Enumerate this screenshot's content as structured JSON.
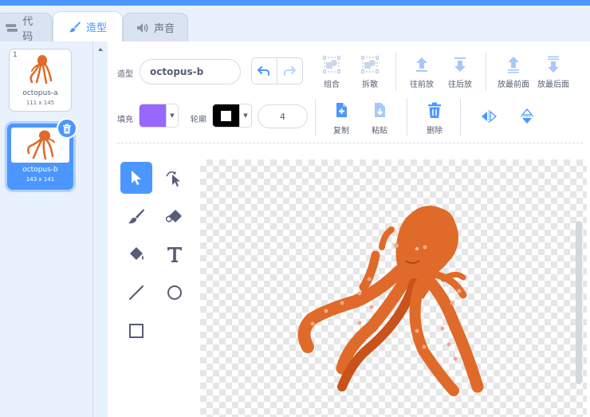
{
  "tabs": [
    {
      "label": "代码",
      "icon": "code-icon"
    },
    {
      "label": "造型",
      "icon": "brush-icon"
    },
    {
      "label": "声音",
      "icon": "speaker-icon"
    }
  ],
  "costumes": [
    {
      "index": "1",
      "name": "octopus-a",
      "size": "111 x 145"
    },
    {
      "index": "2",
      "name": "octopus-b",
      "size": "143 x 141"
    }
  ],
  "toolbar": {
    "costume_label": "造型",
    "costume_name": "octopus-b",
    "group": "组合",
    "ungroup": "拆散",
    "forward": "往前放",
    "backward": "往后放",
    "front": "放最前面",
    "back": "放最后面",
    "fill_label": "填充",
    "outline_label": "轮廓",
    "stroke_width": "4",
    "copy": "复制",
    "paste": "粘贴",
    "delete": "删除"
  },
  "colors": {
    "accent": "#4c97ff",
    "fill": "#9966ff",
    "outline": "#000000",
    "octopus": "#e06a2a"
  }
}
